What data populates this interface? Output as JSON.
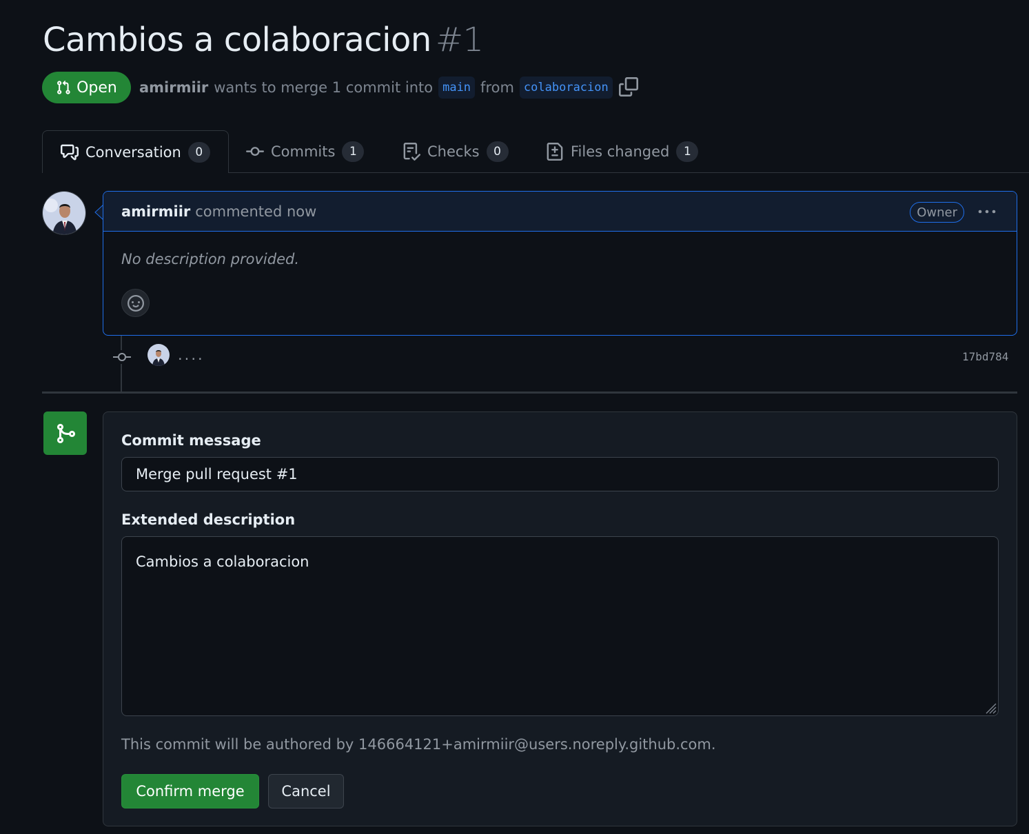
{
  "pr": {
    "title": "Cambios a colaboracion",
    "number": "#1",
    "state": "Open",
    "author": "amirmiir",
    "merge_text_1": "wants to merge 1 commit into",
    "base_branch": "main",
    "merge_text_2": "from",
    "head_branch": "colaboracion"
  },
  "tabs": [
    {
      "label": "Conversation",
      "count": "0",
      "icon": "comment-discussion-icon"
    },
    {
      "label": "Commits",
      "count": "1",
      "icon": "git-commit-icon"
    },
    {
      "label": "Checks",
      "count": "0",
      "icon": "checklist-icon"
    },
    {
      "label": "Files changed",
      "count": "1",
      "icon": "file-diff-icon"
    }
  ],
  "comment": {
    "author": "amirmiir",
    "meta": "commented now",
    "role_badge": "Owner",
    "body": "No description provided."
  },
  "commit": {
    "message": "....",
    "sha": "17bd784"
  },
  "merge": {
    "commit_message_label": "Commit message",
    "commit_message_value": "Merge pull request #1",
    "extended_label": "Extended description",
    "extended_value": "Cambios a colaboracion",
    "author_note": "This commit will be authored by 146664121+amirmiir@users.noreply.github.com.",
    "confirm_label": "Confirm merge",
    "cancel_label": "Cancel"
  },
  "colors": {
    "background": "#0d1117",
    "green": "#238636",
    "accent_blue": "#1f6feb",
    "link_blue": "#4493f8"
  }
}
